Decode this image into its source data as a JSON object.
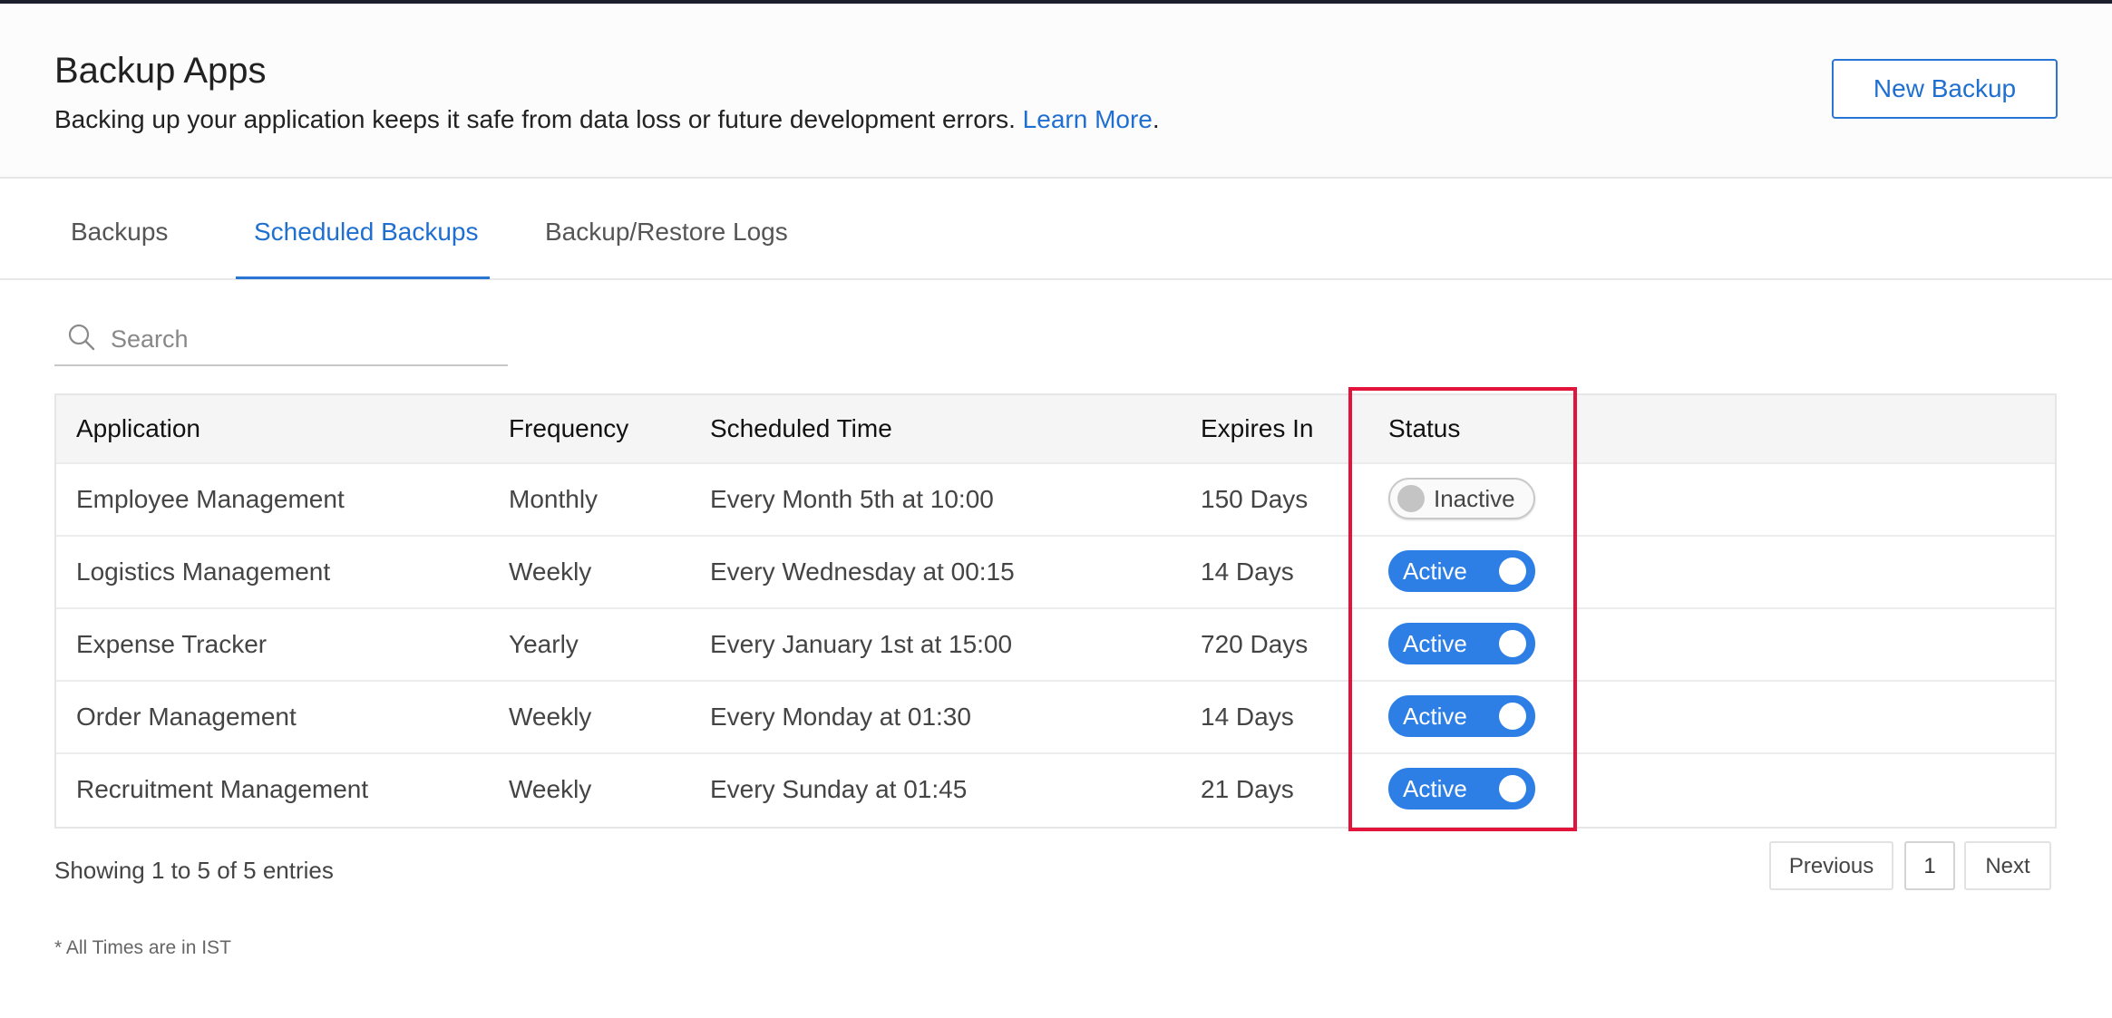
{
  "header": {
    "title": "Backup Apps",
    "description": "Backing up your application keeps it safe from data loss or future development errors.",
    "learn_more": "Learn More",
    "period": ".",
    "new_backup_label": "New Backup"
  },
  "tabs": [
    {
      "label": "Backups",
      "active": false
    },
    {
      "label": "Scheduled Backups",
      "active": true
    },
    {
      "label": "Backup/Restore Logs",
      "active": false
    }
  ],
  "search": {
    "placeholder": "Search",
    "value": ""
  },
  "table": {
    "columns": [
      "Application",
      "Frequency",
      "Scheduled Time",
      "Expires In",
      "Status"
    ],
    "rows": [
      {
        "application": "Employee Management",
        "frequency": "Monthly",
        "scheduled_time": "Every Month 5th at 10:00",
        "expires_in": "150 Days",
        "status": "Inactive"
      },
      {
        "application": "Logistics Management",
        "frequency": "Weekly",
        "scheduled_time": "Every Wednesday at 00:15",
        "expires_in": "14 Days",
        "status": "Active"
      },
      {
        "application": "Expense Tracker",
        "frequency": "Yearly",
        "scheduled_time": "Every January 1st at 15:00",
        "expires_in": "720 Days",
        "status": "Active"
      },
      {
        "application": "Order Management",
        "frequency": "Weekly",
        "scheduled_time": "Every Monday at 01:30",
        "expires_in": "14 Days",
        "status": "Active"
      },
      {
        "application": "Recruitment Management",
        "frequency": "Weekly",
        "scheduled_time": "Every Sunday at 01:45",
        "expires_in": "21 Days",
        "status": "Active"
      }
    ]
  },
  "footer": {
    "entries_text": "Showing 1 to 5 of 5 entries",
    "previous_label": "Previous",
    "current_page": "1",
    "next_label": "Next",
    "note": "* All Times are in IST"
  },
  "colors": {
    "accent": "#2d7fe6",
    "link": "#1f6fd0",
    "highlight_border": "#e3143c",
    "topbar": "#1b1e2b"
  },
  "icons": {
    "search": "search-icon",
    "toggle_knob": "toggle-knob-icon"
  }
}
